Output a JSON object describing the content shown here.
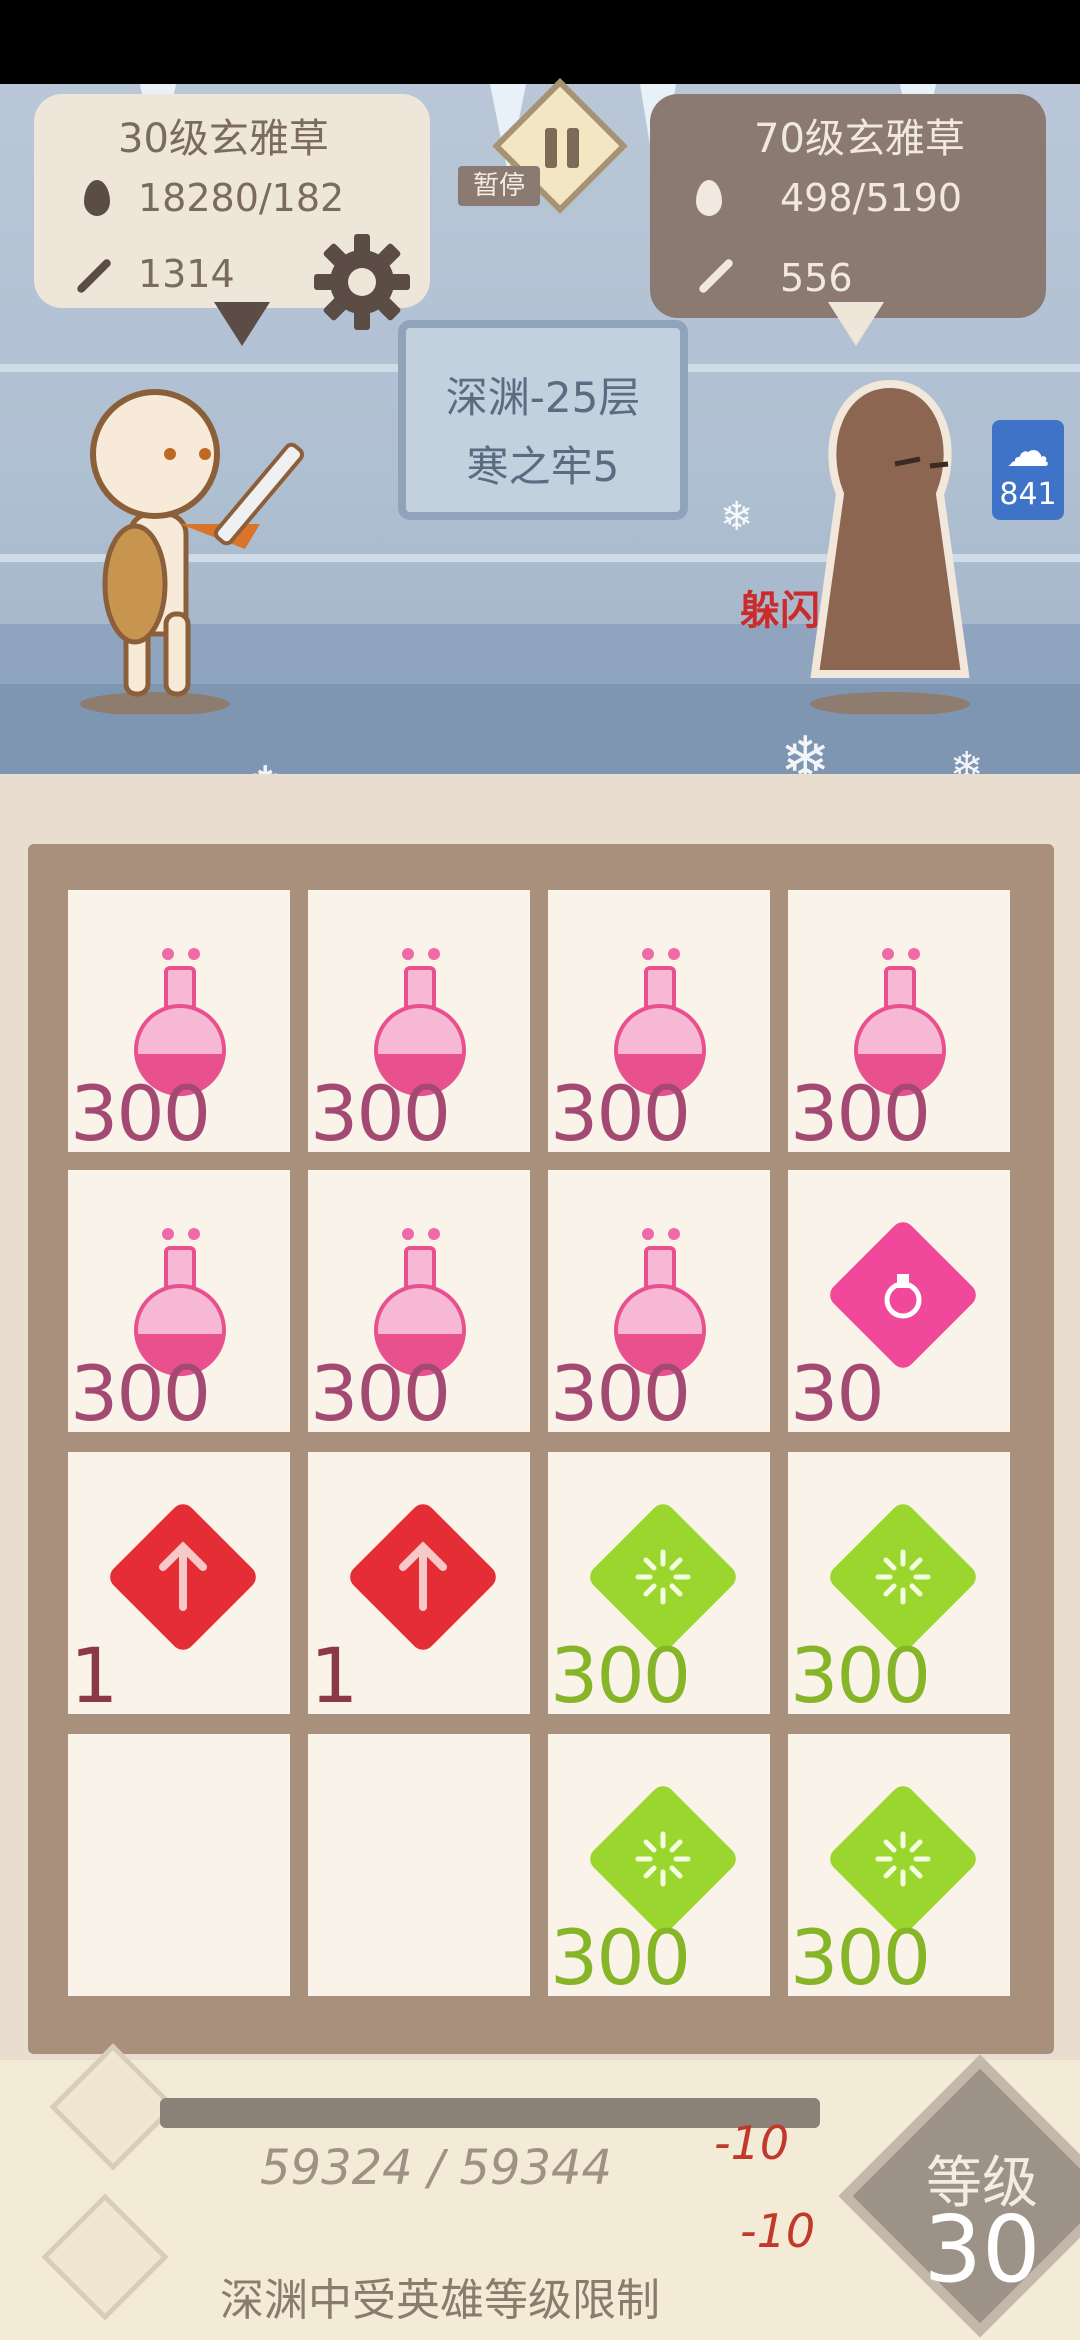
{
  "player": {
    "title": "30级玄雅草",
    "hp": "18280/182",
    "attack": "1314"
  },
  "enemy": {
    "title": "70级玄雅草",
    "hp": "498/5190",
    "attack": "556"
  },
  "pause_label": "暂停",
  "stage": {
    "line1": "深渊-25层",
    "line2": "寒之牢5"
  },
  "dodge_text": "躲闪",
  "enemy_buff_count": "841",
  "inventory": [
    {
      "item": "pink-potion",
      "qty": "300"
    },
    {
      "item": "pink-potion",
      "qty": "300"
    },
    {
      "item": "pink-potion",
      "qty": "300"
    },
    {
      "item": "pink-potion",
      "qty": "300"
    },
    {
      "item": "pink-potion",
      "qty": "300"
    },
    {
      "item": "pink-potion",
      "qty": "300"
    },
    {
      "item": "pink-potion",
      "qty": "300"
    },
    {
      "item": "pink-potion-gem",
      "qty": "30"
    },
    {
      "item": "red-arrow-gem",
      "qty": "1"
    },
    {
      "item": "red-arrow-gem",
      "qty": "1"
    },
    {
      "item": "green-gem",
      "qty": "300"
    },
    {
      "item": "green-gem",
      "qty": "300"
    },
    {
      "item": "empty",
      "qty": ""
    },
    {
      "item": "empty",
      "qty": ""
    },
    {
      "item": "green-gem",
      "qty": "300"
    },
    {
      "item": "green-gem",
      "qty": "300"
    }
  ],
  "experience": {
    "text": "59324 / 59344",
    "fraction": 0.9997
  },
  "damage_popups": [
    "-10",
    "-10"
  ],
  "limit_text": "深渊中受英雄等级限制",
  "level": {
    "label": "等级",
    "value": "30"
  },
  "colors": {
    "pink": "#e8508e",
    "red": "#e52d36",
    "green": "#9ad62e",
    "panel": "#efe6da",
    "board": "#a8907c"
  }
}
